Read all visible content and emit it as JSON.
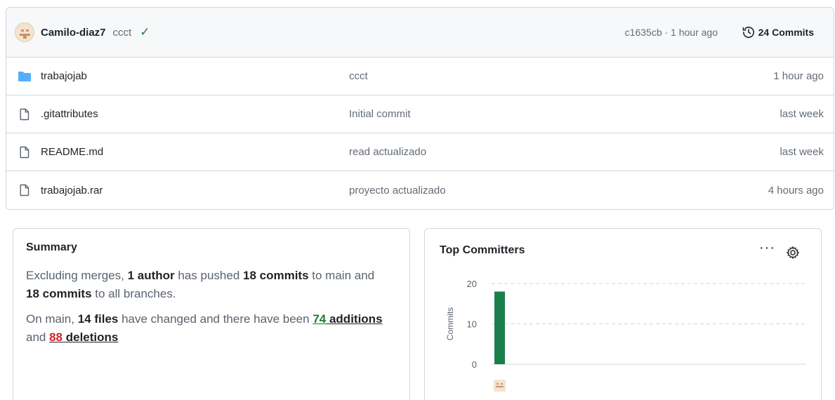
{
  "latest_commit": {
    "author": "Camilo-diaz7",
    "message": "ccct",
    "meta": "c1635cb · 1 hour ago",
    "commits_count": "24 Commits"
  },
  "files": [
    {
      "icon": "folder-icon",
      "name": "trabajojab",
      "commit": "ccct",
      "time": "1 hour ago"
    },
    {
      "icon": "file-icon",
      "name": ".gitattributes",
      "commit": "Initial commit",
      "time": "last week"
    },
    {
      "icon": "file-icon",
      "name": "README.md",
      "commit": "read actualizado",
      "time": "last week"
    },
    {
      "icon": "file-icon",
      "name": "trabajojab.rar",
      "commit": "proyecto actualizado",
      "time": "4 hours ago"
    }
  ],
  "summary": {
    "title": "Summary",
    "p1": {
      "t1": "Excluding merges, ",
      "b1": "1 author",
      "t2": " has pushed ",
      "b2": "18 commits",
      "t3": " to main and ",
      "b3": "18 commits",
      "t4": " to all branches."
    },
    "p2": {
      "t1": "On main, ",
      "b1": "14 files",
      "t2": " have changed and there have been ",
      "add_n": "74",
      "add_w": "additions",
      "t3": " and ",
      "del_n": "88",
      "del_w": "deletions"
    }
  },
  "top_committers": {
    "title": "Top Committers",
    "more_label": "···"
  },
  "colors": {
    "bar": "#1a7f4b",
    "folder": "#54aeff",
    "added": "#1a7f37",
    "deleted": "#cf222e"
  },
  "chart_data": {
    "type": "bar",
    "categories": [
      "Camilo-diaz7"
    ],
    "values": [
      18
    ],
    "ylabel": "Commits",
    "ylim": [
      0,
      20
    ],
    "yticks": [
      0,
      10,
      20
    ],
    "grid": true
  }
}
